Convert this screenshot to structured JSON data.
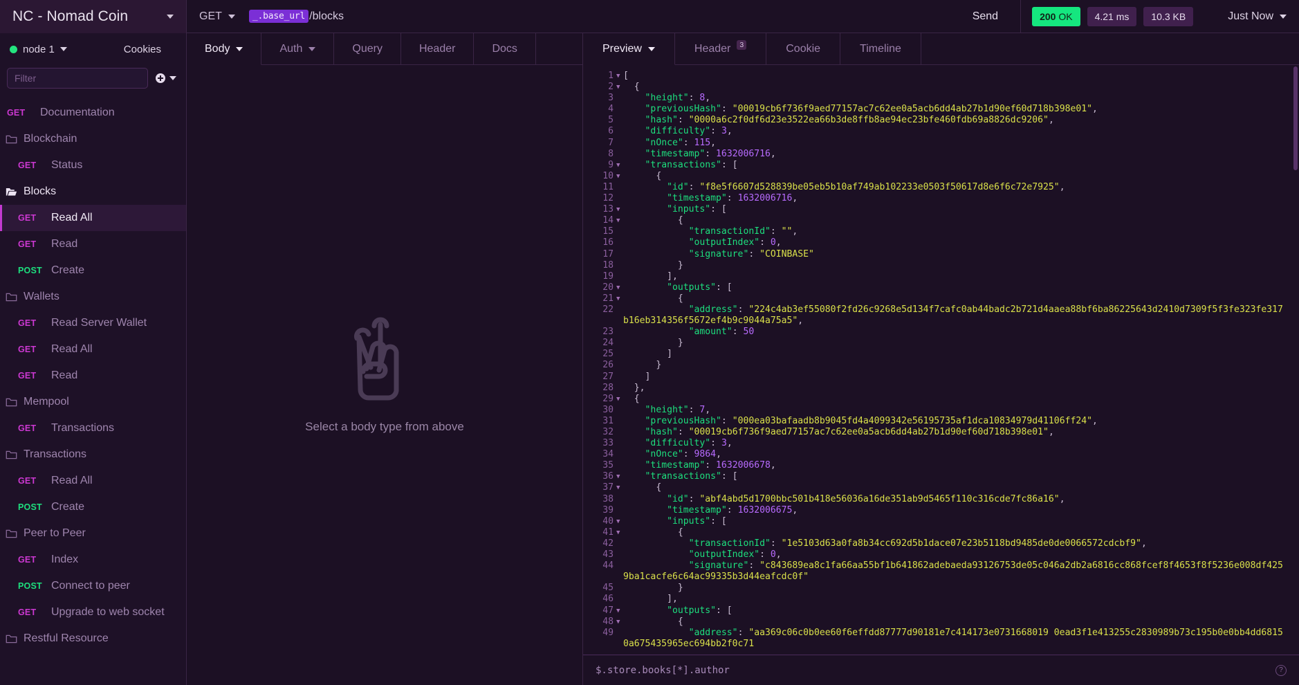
{
  "brand": {
    "title": "NC - Nomad Coin",
    "caret_icon": "chevron-down-icon"
  },
  "request": {
    "method": "GET",
    "url_variable": "_.base_url",
    "url_path": "/blocks",
    "send_label": "Send"
  },
  "response_status": {
    "code": "200",
    "text": "OK",
    "time": "4.21 ms",
    "size": "10.3 KB",
    "timestamp_label": "Just Now"
  },
  "sidebar": {
    "node_label": "node 1",
    "cookies_label": "Cookies",
    "filter_placeholder": "Filter",
    "add_icon": "plus-circle-icon",
    "items": [
      {
        "type": "endpoint",
        "verb": "GET",
        "label": "Documentation",
        "indent": 0,
        "selected": false
      },
      {
        "type": "folder",
        "label": "Blockchain",
        "open": false,
        "active": false
      },
      {
        "type": "endpoint",
        "verb": "GET",
        "label": "Status",
        "indent": 1,
        "selected": false
      },
      {
        "type": "folder",
        "label": "Blocks",
        "open": true,
        "active": true
      },
      {
        "type": "endpoint",
        "verb": "GET",
        "label": "Read All",
        "indent": 1,
        "selected": true
      },
      {
        "type": "endpoint",
        "verb": "GET",
        "label": "Read",
        "indent": 1,
        "selected": false
      },
      {
        "type": "endpoint",
        "verb": "POST",
        "label": "Create",
        "indent": 1,
        "selected": false
      },
      {
        "type": "folder",
        "label": "Wallets",
        "open": false,
        "active": false
      },
      {
        "type": "endpoint",
        "verb": "GET",
        "label": "Read Server Wallet",
        "indent": 1,
        "selected": false
      },
      {
        "type": "endpoint",
        "verb": "GET",
        "label": "Read All",
        "indent": 1,
        "selected": false
      },
      {
        "type": "endpoint",
        "verb": "GET",
        "label": "Read",
        "indent": 1,
        "selected": false
      },
      {
        "type": "folder",
        "label": "Mempool",
        "open": false,
        "active": false
      },
      {
        "type": "endpoint",
        "verb": "GET",
        "label": "Transactions",
        "indent": 1,
        "selected": false
      },
      {
        "type": "folder",
        "label": "Transactions",
        "open": false,
        "active": false
      },
      {
        "type": "endpoint",
        "verb": "GET",
        "label": "Read All",
        "indent": 1,
        "selected": false
      },
      {
        "type": "endpoint",
        "verb": "POST",
        "label": "Create",
        "indent": 1,
        "selected": false
      },
      {
        "type": "folder",
        "label": "Peer to Peer",
        "open": false,
        "active": false
      },
      {
        "type": "endpoint",
        "verb": "GET",
        "label": "Index",
        "indent": 1,
        "selected": false
      },
      {
        "type": "endpoint",
        "verb": "POST",
        "label": "Connect to peer",
        "indent": 1,
        "selected": false
      },
      {
        "type": "endpoint",
        "verb": "GET",
        "label": "Upgrade to web socket",
        "indent": 1,
        "selected": false
      },
      {
        "type": "folder",
        "label": "Restful Resource",
        "open": false,
        "active": false
      }
    ]
  },
  "request_tabs": [
    {
      "label": "Body",
      "active": true,
      "caret": true
    },
    {
      "label": "Auth",
      "active": false,
      "caret": true
    },
    {
      "label": "Query",
      "active": false,
      "caret": false
    },
    {
      "label": "Header",
      "active": false,
      "caret": false
    },
    {
      "label": "Docs",
      "active": false,
      "caret": false
    }
  ],
  "request_body": {
    "empty_icon": "peace-hand-icon",
    "empty_text": "Select a body type from above"
  },
  "response_tabs": [
    {
      "label": "Preview",
      "active": true,
      "caret": true,
      "badge": ""
    },
    {
      "label": "Header",
      "active": false,
      "caret": false,
      "badge": "3"
    },
    {
      "label": "Cookie",
      "active": false,
      "caret": false,
      "badge": ""
    },
    {
      "label": "Timeline",
      "active": false,
      "caret": false,
      "badge": ""
    }
  ],
  "jsonpath": {
    "value": "$.store.books[*].author",
    "help_icon": "question-circle-icon"
  },
  "response_body_lines": [
    {
      "n": 1,
      "fold": true,
      "indent": 0,
      "tokens": [
        [
          "p",
          "["
        ]
      ]
    },
    {
      "n": 2,
      "fold": true,
      "indent": 1,
      "tokens": [
        [
          "p",
          "{"
        ]
      ]
    },
    {
      "n": 3,
      "fold": false,
      "indent": 2,
      "tokens": [
        [
          "k",
          "\"height\""
        ],
        [
          "p",
          ": "
        ],
        [
          "n",
          "8"
        ],
        [
          "p",
          ","
        ]
      ]
    },
    {
      "n": 4,
      "fold": false,
      "indent": 2,
      "tokens": [
        [
          "k",
          "\"previousHash\""
        ],
        [
          "p",
          ": "
        ],
        [
          "s",
          "\"00019cb6f736f9aed77157ac7c62ee0a5acb6dd4ab27b1d90ef60d718b398e01\""
        ],
        [
          "p",
          ","
        ]
      ]
    },
    {
      "n": 5,
      "fold": false,
      "indent": 2,
      "tokens": [
        [
          "k",
          "\"hash\""
        ],
        [
          "p",
          ": "
        ],
        [
          "s",
          "\"0000a6c2f0df6d23e3522ea66b3de8ffb8ae94ec23bfe460fdb69a8826dc9206\""
        ],
        [
          "p",
          ","
        ]
      ]
    },
    {
      "n": 6,
      "fold": false,
      "indent": 2,
      "tokens": [
        [
          "k",
          "\"difficulty\""
        ],
        [
          "p",
          ": "
        ],
        [
          "n",
          "3"
        ],
        [
          "p",
          ","
        ]
      ]
    },
    {
      "n": 7,
      "fold": false,
      "indent": 2,
      "tokens": [
        [
          "k",
          "\"nOnce\""
        ],
        [
          "p",
          ": "
        ],
        [
          "n",
          "115"
        ],
        [
          "p",
          ","
        ]
      ]
    },
    {
      "n": 8,
      "fold": false,
      "indent": 2,
      "tokens": [
        [
          "k",
          "\"timestamp\""
        ],
        [
          "p",
          ": "
        ],
        [
          "n",
          "1632006716"
        ],
        [
          "p",
          ","
        ]
      ]
    },
    {
      "n": 9,
      "fold": true,
      "indent": 2,
      "tokens": [
        [
          "k",
          "\"transactions\""
        ],
        [
          "p",
          ": ["
        ]
      ]
    },
    {
      "n": 10,
      "fold": true,
      "indent": 3,
      "tokens": [
        [
          "p",
          "{"
        ]
      ]
    },
    {
      "n": 11,
      "fold": false,
      "indent": 4,
      "tokens": [
        [
          "k",
          "\"id\""
        ],
        [
          "p",
          ": "
        ],
        [
          "s",
          "\"f8e5f6607d528839be05eb5b10af749ab102233e0503f50617d8e6f6c72e7925\""
        ],
        [
          "p",
          ","
        ]
      ]
    },
    {
      "n": 12,
      "fold": false,
      "indent": 4,
      "tokens": [
        [
          "k",
          "\"timestamp\""
        ],
        [
          "p",
          ": "
        ],
        [
          "n",
          "1632006716"
        ],
        [
          "p",
          ","
        ]
      ]
    },
    {
      "n": 13,
      "fold": true,
      "indent": 4,
      "tokens": [
        [
          "k",
          "\"inputs\""
        ],
        [
          "p",
          ": ["
        ]
      ]
    },
    {
      "n": 14,
      "fold": true,
      "indent": 5,
      "tokens": [
        [
          "p",
          "{"
        ]
      ]
    },
    {
      "n": 15,
      "fold": false,
      "indent": 6,
      "tokens": [
        [
          "k",
          "\"transactionId\""
        ],
        [
          "p",
          ": "
        ],
        [
          "s",
          "\"\""
        ],
        [
          "p",
          ","
        ]
      ]
    },
    {
      "n": 16,
      "fold": false,
      "indent": 6,
      "tokens": [
        [
          "k",
          "\"outputIndex\""
        ],
        [
          "p",
          ": "
        ],
        [
          "n",
          "0"
        ],
        [
          "p",
          ","
        ]
      ]
    },
    {
      "n": 17,
      "fold": false,
      "indent": 6,
      "tokens": [
        [
          "k",
          "\"signature\""
        ],
        [
          "p",
          ": "
        ],
        [
          "s",
          "\"COINBASE\""
        ]
      ]
    },
    {
      "n": 18,
      "fold": false,
      "indent": 5,
      "tokens": [
        [
          "p",
          "}"
        ]
      ]
    },
    {
      "n": 19,
      "fold": false,
      "indent": 4,
      "tokens": [
        [
          "p",
          "],"
        ]
      ]
    },
    {
      "n": 20,
      "fold": true,
      "indent": 4,
      "tokens": [
        [
          "k",
          "\"outputs\""
        ],
        [
          "p",
          ": ["
        ]
      ]
    },
    {
      "n": 21,
      "fold": true,
      "indent": 5,
      "tokens": [
        [
          "p",
          "{"
        ]
      ]
    },
    {
      "n": 22,
      "fold": false,
      "indent": 6,
      "wrap": true,
      "tokens": [
        [
          "k",
          "\"address\""
        ],
        [
          "p",
          ": "
        ],
        [
          "s",
          "\"224c4ab3ef55080f2fd26c9268e5d134f7cafc0ab44badc2b721d4aaea88bf6ba86225643d2410d7309f5f3fe323fe317b16eb314356f5672ef4b9c9044a75a5\""
        ],
        [
          "p",
          ","
        ]
      ]
    },
    {
      "n": 23,
      "fold": false,
      "indent": 6,
      "tokens": [
        [
          "k",
          "\"amount\""
        ],
        [
          "p",
          ": "
        ],
        [
          "n",
          "50"
        ]
      ]
    },
    {
      "n": 24,
      "fold": false,
      "indent": 5,
      "tokens": [
        [
          "p",
          "}"
        ]
      ]
    },
    {
      "n": 25,
      "fold": false,
      "indent": 4,
      "tokens": [
        [
          "p",
          "]"
        ]
      ]
    },
    {
      "n": 26,
      "fold": false,
      "indent": 3,
      "tokens": [
        [
          "p",
          "}"
        ]
      ]
    },
    {
      "n": 27,
      "fold": false,
      "indent": 2,
      "tokens": [
        [
          "p",
          "]"
        ]
      ]
    },
    {
      "n": 28,
      "fold": false,
      "indent": 1,
      "tokens": [
        [
          "p",
          "},"
        ]
      ]
    },
    {
      "n": 29,
      "fold": true,
      "indent": 1,
      "tokens": [
        [
          "p",
          "{"
        ]
      ]
    },
    {
      "n": 30,
      "fold": false,
      "indent": 2,
      "tokens": [
        [
          "k",
          "\"height\""
        ],
        [
          "p",
          ": "
        ],
        [
          "n",
          "7"
        ],
        [
          "p",
          ","
        ]
      ]
    },
    {
      "n": 31,
      "fold": false,
      "indent": 2,
      "tokens": [
        [
          "k",
          "\"previousHash\""
        ],
        [
          "p",
          ": "
        ],
        [
          "s",
          "\"000ea03bafaadb8b9045fd4a4099342e56195735af1dca10834979d41106ff24\""
        ],
        [
          "p",
          ","
        ]
      ]
    },
    {
      "n": 32,
      "fold": false,
      "indent": 2,
      "tokens": [
        [
          "k",
          "\"hash\""
        ],
        [
          "p",
          ": "
        ],
        [
          "s",
          "\"00019cb6f736f9aed77157ac7c62ee0a5acb6dd4ab27b1d90ef60d718b398e01\""
        ],
        [
          "p",
          ","
        ]
      ]
    },
    {
      "n": 33,
      "fold": false,
      "indent": 2,
      "tokens": [
        [
          "k",
          "\"difficulty\""
        ],
        [
          "p",
          ": "
        ],
        [
          "n",
          "3"
        ],
        [
          "p",
          ","
        ]
      ]
    },
    {
      "n": 34,
      "fold": false,
      "indent": 2,
      "tokens": [
        [
          "k",
          "\"nOnce\""
        ],
        [
          "p",
          ": "
        ],
        [
          "n",
          "9864"
        ],
        [
          "p",
          ","
        ]
      ]
    },
    {
      "n": 35,
      "fold": false,
      "indent": 2,
      "tokens": [
        [
          "k",
          "\"timestamp\""
        ],
        [
          "p",
          ": "
        ],
        [
          "n",
          "1632006678"
        ],
        [
          "p",
          ","
        ]
      ]
    },
    {
      "n": 36,
      "fold": true,
      "indent": 2,
      "tokens": [
        [
          "k",
          "\"transactions\""
        ],
        [
          "p",
          ": ["
        ]
      ]
    },
    {
      "n": 37,
      "fold": true,
      "indent": 3,
      "tokens": [
        [
          "p",
          "{"
        ]
      ]
    },
    {
      "n": 38,
      "fold": false,
      "indent": 4,
      "tokens": [
        [
          "k",
          "\"id\""
        ],
        [
          "p",
          ": "
        ],
        [
          "s",
          "\"abf4abd5d1700bbc501b418e56036a16de351ab9d5465f110c316cde7fc86a16\""
        ],
        [
          "p",
          ","
        ]
      ]
    },
    {
      "n": 39,
      "fold": false,
      "indent": 4,
      "tokens": [
        [
          "k",
          "\"timestamp\""
        ],
        [
          "p",
          ": "
        ],
        [
          "n",
          "1632006675"
        ],
        [
          "p",
          ","
        ]
      ]
    },
    {
      "n": 40,
      "fold": true,
      "indent": 4,
      "tokens": [
        [
          "k",
          "\"inputs\""
        ],
        [
          "p",
          ": ["
        ]
      ]
    },
    {
      "n": 41,
      "fold": true,
      "indent": 5,
      "tokens": [
        [
          "p",
          "{"
        ]
      ]
    },
    {
      "n": 42,
      "fold": false,
      "indent": 6,
      "tokens": [
        [
          "k",
          "\"transactionId\""
        ],
        [
          "p",
          ": "
        ],
        [
          "s",
          "\"1e5103d63a0fa8b34cc692d5b1dace07e23b5118bd9485de0de0066572cdcbf9\""
        ],
        [
          "p",
          ","
        ]
      ]
    },
    {
      "n": 43,
      "fold": false,
      "indent": 6,
      "tokens": [
        [
          "k",
          "\"outputIndex\""
        ],
        [
          "p",
          ": "
        ],
        [
          "n",
          "0"
        ],
        [
          "p",
          ","
        ]
      ]
    },
    {
      "n": 44,
      "fold": false,
      "indent": 6,
      "wrap": true,
      "tokens": [
        [
          "k",
          "\"signature\""
        ],
        [
          "p",
          ": "
        ],
        [
          "s",
          "\"c843689ea8c1fa66aa55bf1b641862adebaeda93126753de05c046a2db2a6816cc868fcef8f4653f8f5236e008df4259ba1cacfe6c64ac99335b3d44eafcdc0f\""
        ]
      ]
    },
    {
      "n": 45,
      "fold": false,
      "indent": 5,
      "tokens": [
        [
          "p",
          "}"
        ]
      ]
    },
    {
      "n": 46,
      "fold": false,
      "indent": 4,
      "tokens": [
        [
          "p",
          "],"
        ]
      ]
    },
    {
      "n": 47,
      "fold": true,
      "indent": 4,
      "tokens": [
        [
          "k",
          "\"outputs\""
        ],
        [
          "p",
          ": ["
        ]
      ]
    },
    {
      "n": 48,
      "fold": true,
      "indent": 5,
      "tokens": [
        [
          "p",
          "{"
        ]
      ]
    },
    {
      "n": 49,
      "fold": false,
      "indent": 6,
      "wrap": true,
      "tokens": [
        [
          "k",
          "\"address\""
        ],
        [
          "p",
          ": "
        ],
        [
          "s",
          "\"aa369c06c0b0ee60f6effdd87777d90181e7c414173e0731668019 0ead3f1e413255c2830989b73c195b0e0bb4dd68150a675435965ec694bb2f0c71"
        ]
      ]
    }
  ]
}
